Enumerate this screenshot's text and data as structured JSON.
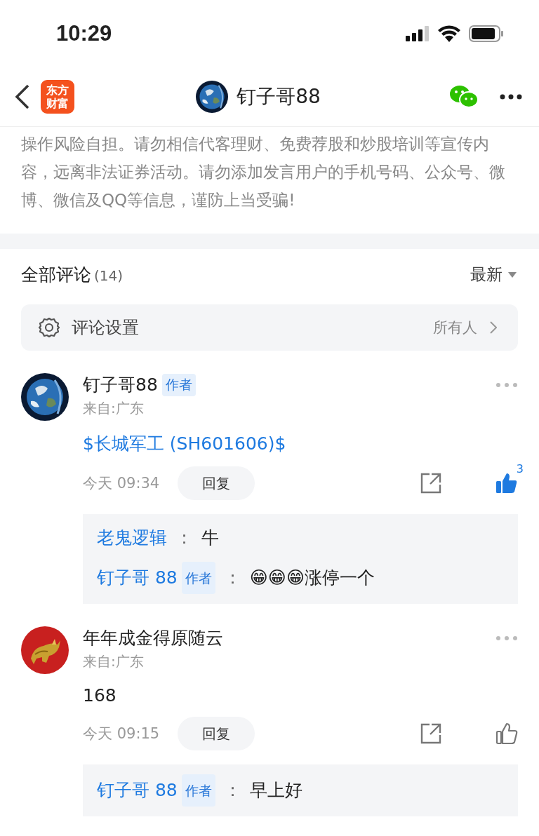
{
  "status_bar": {
    "time": "10:29"
  },
  "nav": {
    "logo_lines": [
      "东方",
      "财富"
    ],
    "title": "钉子哥88"
  },
  "notice": {
    "text": "操作风险自担。请勿相信代客理财、免费荐股和炒股培训等宣传内容，远离非法证券活动。请勿添加发言用户的手机号码、公众号、微博、微信及QQ等信息，谨防上当受骗!"
  },
  "comments_header": {
    "title": "全部评论",
    "count": "(14)",
    "sort": "最新"
  },
  "settings_row": {
    "label": "评论设置",
    "value": "所有人"
  },
  "comments": [
    {
      "user": "钉子哥88",
      "badge": "作者",
      "location": "来自:广东",
      "body": "$长城军工 (SH601606)$",
      "link": true,
      "time": "今天 09:34",
      "reply_label": "回复",
      "liked": true,
      "like_count": "3",
      "replies": [
        {
          "user": "老鬼逻辑",
          "colon": "：",
          "text": "牛"
        },
        {
          "user": "钉子哥 88",
          "badge": "作者",
          "colon": "：",
          "text": "😁😁😁涨停一个"
        }
      ]
    },
    {
      "user": "年年成金得原随云",
      "location": "来自:广东",
      "body": "168",
      "link": false,
      "time": "今天 09:15",
      "reply_label": "回复",
      "liked": false,
      "replies": [
        {
          "user": "钉子哥 88",
          "badge": "作者",
          "colon": "：",
          "text": "早上好"
        }
      ]
    }
  ]
}
